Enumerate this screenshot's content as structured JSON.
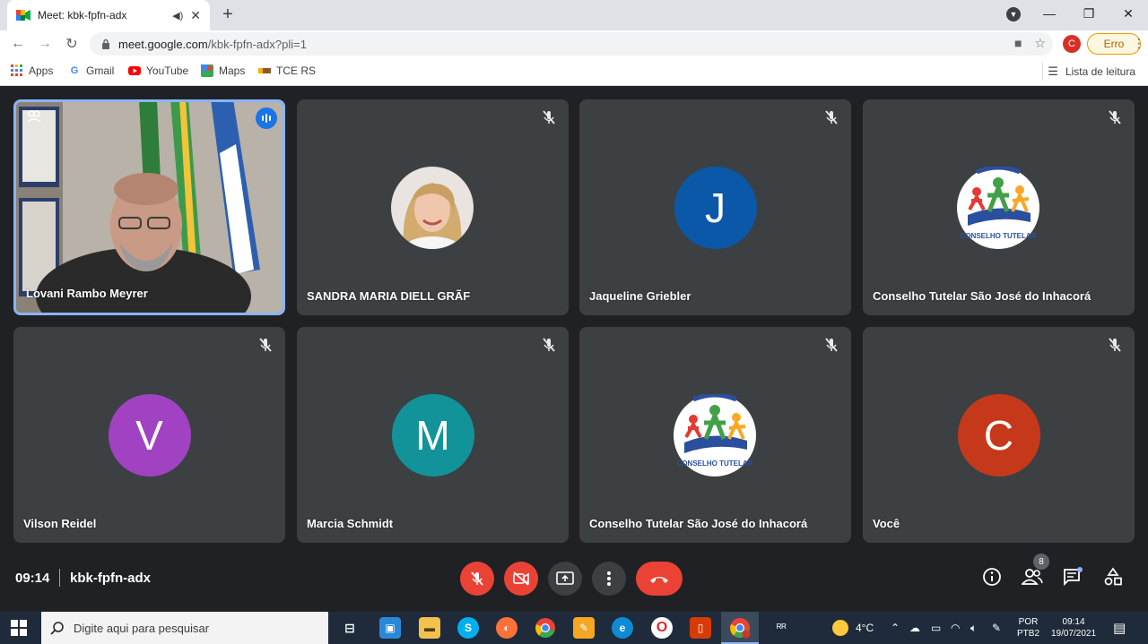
{
  "browser": {
    "tab_title": "Meet: kbk-fpfn-adx",
    "tab_close": "✕",
    "new_tab": "+",
    "url_host": "meet.google.com",
    "url_path": "/kbk-fpfn-adx?pli=1",
    "profile_initial": "C",
    "error_label": "Erro",
    "window_minimize": "—",
    "window_restore": "❐",
    "window_close": "✕",
    "bookmarks": [
      {
        "label": "Apps"
      },
      {
        "label": "Gmail"
      },
      {
        "label": "YouTube"
      },
      {
        "label": "Maps"
      },
      {
        "label": "TCE RS"
      }
    ],
    "reading_list": "Lista de leitura"
  },
  "participants": [
    {
      "name": "Lovani Rambo Meyrer",
      "type": "video",
      "speaking": true
    },
    {
      "name": "SANDRA MARIA DIELL GRÃF",
      "type": "photo",
      "muted": true
    },
    {
      "name": "Jaqueline Griebler",
      "type": "initial",
      "initial": "J",
      "color": "#0b57a8",
      "muted": true
    },
    {
      "name": "Conselho Tutelar São José do Inhacorá",
      "type": "logo",
      "logo_text": "CONSELHO TUTELAR",
      "muted": true
    },
    {
      "name": "Vilson Reidel",
      "type": "initial",
      "initial": "V",
      "color": "#a142c2",
      "muted": true
    },
    {
      "name": "Marcia Schmidt",
      "type": "initial",
      "initial": "M",
      "color": "#12939a",
      "muted": true
    },
    {
      "name": "Conselho Tutelar São José do Inhacorá",
      "type": "logo",
      "logo_text": "CONSELHO TUTELAR",
      "muted": true
    },
    {
      "name": "Você",
      "type": "initial",
      "initial": "C",
      "color": "#c5391a",
      "muted": true
    }
  ],
  "meeting": {
    "time": "09:14",
    "code": "kbk-fpfn-adx",
    "people_count": "8"
  },
  "taskbar": {
    "search_placeholder": "Digite aqui para pesquisar",
    "temperature": "4°C",
    "lang_top": "POR",
    "lang_bottom": "PTB2",
    "clock_time": "09:14",
    "clock_date": "19/07/2021"
  },
  "colors": {
    "accent_blue": "#1a73e8",
    "danger_red": "#ea4335",
    "tile_bg": "#3c4043",
    "stage_bg": "#202124"
  }
}
